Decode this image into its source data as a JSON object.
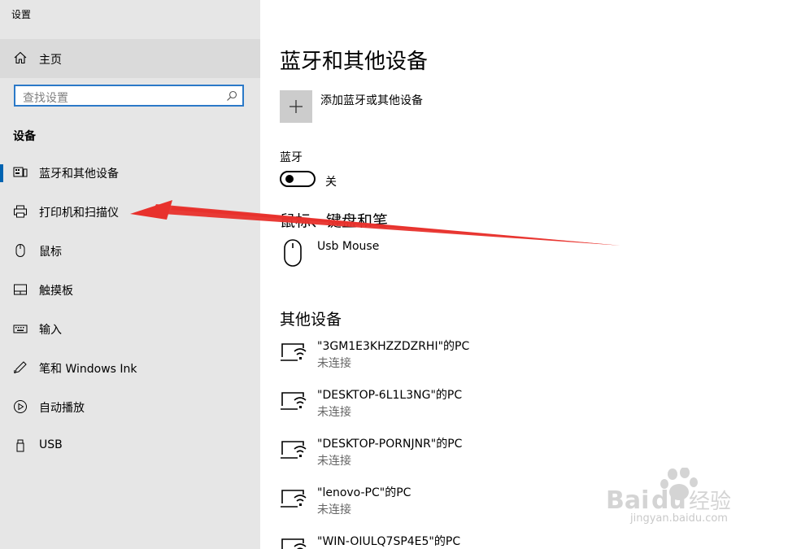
{
  "window": {
    "title": "设置"
  },
  "sidebar": {
    "home_label": "主页",
    "search_placeholder": "查找设置",
    "section_title": "设备",
    "items": [
      {
        "label": "蓝牙和其他设备",
        "icon": "bluetooth-devices-icon",
        "active": true
      },
      {
        "label": "打印机和扫描仪",
        "icon": "printer-icon",
        "active": false
      },
      {
        "label": "鼠标",
        "icon": "mouse-icon",
        "active": false
      },
      {
        "label": "触摸板",
        "icon": "touchpad-icon",
        "active": false
      },
      {
        "label": "输入",
        "icon": "keyboard-icon",
        "active": false
      },
      {
        "label": "笔和 Windows Ink",
        "icon": "pen-icon",
        "active": false
      },
      {
        "label": "自动播放",
        "icon": "autoplay-icon",
        "active": false
      },
      {
        "label": "USB",
        "icon": "usb-icon",
        "active": false
      }
    ]
  },
  "main": {
    "title": "蓝牙和其他设备",
    "add_device_label": "添加蓝牙或其他设备",
    "bluetooth_label": "蓝牙",
    "bluetooth_state": "关",
    "mouse_group": {
      "title": "鼠标、键盘和笔",
      "devices": [
        {
          "name": "Usb Mouse"
        }
      ]
    },
    "other_group": {
      "title": "其他设备",
      "devices": [
        {
          "name": "\"3GM1E3KHZZDZRHI\"的PC",
          "status": "未连接"
        },
        {
          "name": "\"DESKTOP-6L1L3NG\"的PC",
          "status": "未连接"
        },
        {
          "name": "\"DESKTOP-PORNJNR\"的PC",
          "status": "未连接"
        },
        {
          "name": "\"lenovo-PC\"的PC",
          "status": "未连接"
        },
        {
          "name": "\"WIN-OIULQ7SP4E5\"的PC",
          "status": ""
        }
      ]
    }
  },
  "watermark": {
    "text": "jingyan.baidu.com"
  },
  "colors": {
    "accent": "#0063b1",
    "arrow": "#e8312c",
    "sidebar_bg": "#e6e6e6",
    "search_border": "#2b79c8"
  }
}
